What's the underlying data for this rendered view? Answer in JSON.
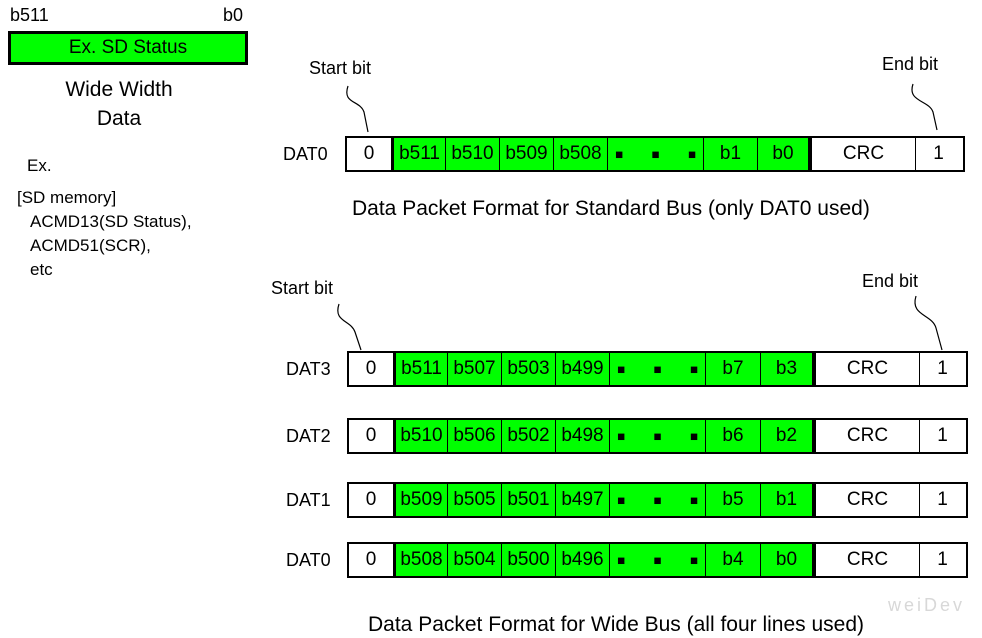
{
  "wide_width": {
    "msb_label": "b511",
    "lsb_label": "b0",
    "box_label": "Ex. SD Status",
    "caption_line1": "Wide Width",
    "caption_line2": "Data",
    "examples": [
      "Ex.",
      "[SD memory]",
      "ACMD13(SD Status),",
      "ACMD51(SCR),",
      "etc"
    ]
  },
  "standard_bus": {
    "start_label": "Start bit",
    "end_label": "End bit",
    "rows": [
      {
        "line": "DAT0",
        "start": "0",
        "bits": [
          "b511",
          "b510",
          "b509",
          "b508"
        ],
        "ellipsis": "▪ ▪ ▪",
        "tail": [
          "b1",
          "b0"
        ],
        "crc": "CRC",
        "end": "1"
      }
    ],
    "caption": "Data Packet Format for Standard Bus (only DAT0 used)"
  },
  "wide_bus": {
    "start_label": "Start bit",
    "end_label": "End bit",
    "rows": [
      {
        "line": "DAT3",
        "start": "0",
        "bits": [
          "b511",
          "b507",
          "b503",
          "b499"
        ],
        "ellipsis": "▪ ▪ ▪",
        "tail": [
          "b7",
          "b3"
        ],
        "crc": "CRC",
        "end": "1"
      },
      {
        "line": "DAT2",
        "start": "0",
        "bits": [
          "b510",
          "b506",
          "b502",
          "b498"
        ],
        "ellipsis": "▪ ▪ ▪",
        "tail": [
          "b6",
          "b2"
        ],
        "crc": "CRC",
        "end": "1"
      },
      {
        "line": "DAT1",
        "start": "0",
        "bits": [
          "b509",
          "b505",
          "b501",
          "b497"
        ],
        "ellipsis": "▪ ▪ ▪",
        "tail": [
          "b5",
          "b1"
        ],
        "crc": "CRC",
        "end": "1"
      },
      {
        "line": "DAT0",
        "start": "0",
        "bits": [
          "b508",
          "b504",
          "b500",
          "b496"
        ],
        "ellipsis": "▪ ▪ ▪",
        "tail": [
          "b4",
          "b0"
        ],
        "crc": "CRC",
        "end": "1"
      }
    ],
    "caption": "Data Packet Format for Wide Bus (all four lines used)"
  },
  "watermark": "weiDev",
  "colors": {
    "data_fill": "#00ff00",
    "background": "#ffffff",
    "line": "#000000"
  }
}
